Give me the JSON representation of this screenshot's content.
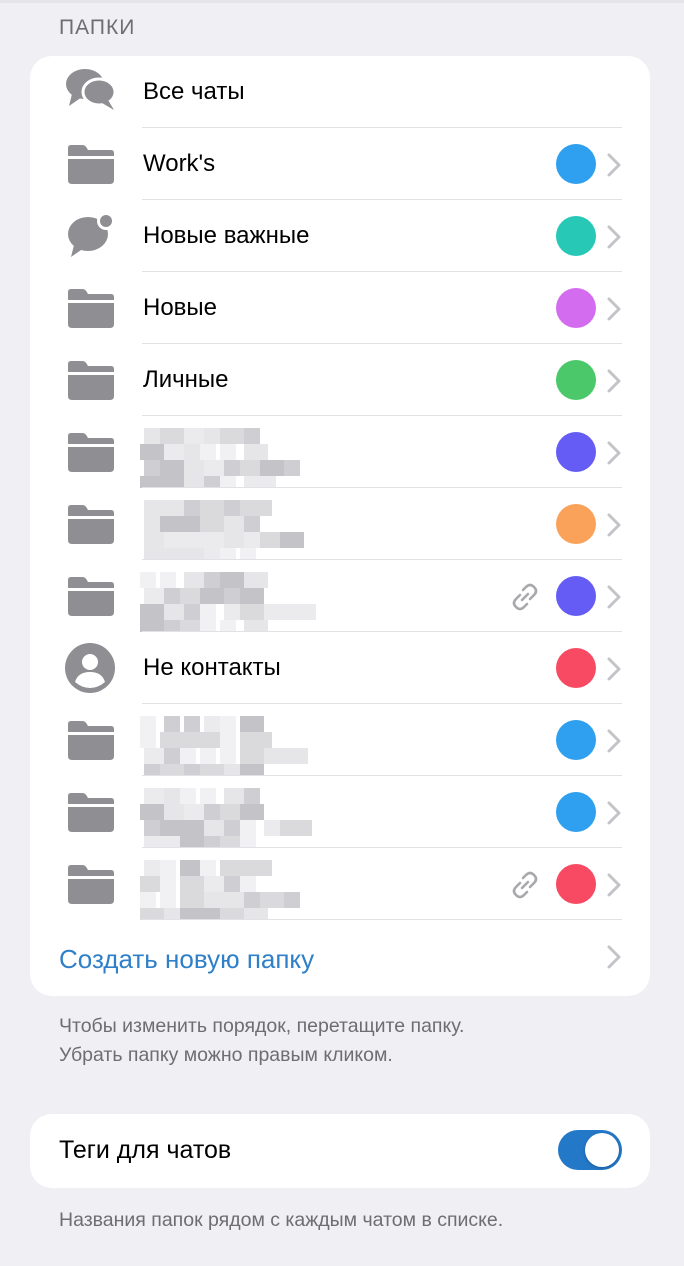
{
  "section_title": "ПАПКИ",
  "folders": [
    {
      "label": "Все чаты",
      "icon": "chat-bubbles-icon",
      "color": null,
      "blurred": false,
      "link": false
    },
    {
      "label": "Work's",
      "icon": "folder-icon",
      "color": "#2f9ff0",
      "blurred": false,
      "link": false
    },
    {
      "label": "Новые важные",
      "icon": "chat-badge-icon",
      "color": "#27c8b6",
      "blurred": false,
      "link": false
    },
    {
      "label": "Новые",
      "icon": "folder-icon",
      "color": "#d46cf0",
      "blurred": false,
      "link": false
    },
    {
      "label": "Личные",
      "icon": "folder-icon",
      "color": "#4bc86a",
      "blurred": false,
      "link": false
    },
    {
      "label": "",
      "icon": "folder-icon",
      "color": "#655bf5",
      "blurred": true,
      "link": false
    },
    {
      "label": "",
      "icon": "folder-icon",
      "color": "#fba25a",
      "blurred": true,
      "link": false
    },
    {
      "label": "",
      "icon": "folder-icon",
      "color": "#655bf5",
      "blurred": true,
      "link": true
    },
    {
      "label": "Не контакты",
      "icon": "person-circle-icon",
      "color": "#f84b63",
      "blurred": false,
      "link": false
    },
    {
      "label": "",
      "icon": "folder-icon",
      "color": "#2f9ff0",
      "blurred": true,
      "link": false
    },
    {
      "label": "",
      "icon": "folder-icon",
      "color": "#2f9ff0",
      "blurred": true,
      "link": false
    },
    {
      "label": "",
      "icon": "folder-icon",
      "color": "#f84b63",
      "blurred": true,
      "link": true
    }
  ],
  "create_folder_label": "Создать новую папку",
  "reorder_hint_line1": "Чтобы изменить порядок, перетащите папку.",
  "reorder_hint_line2": "Убрать папку можно правым кликом.",
  "tags": {
    "label": "Теги для чатов",
    "enabled": true,
    "toggle_color": "#2478c8"
  },
  "tags_hint": "Названия папок рядом с каждым чатом в списке.",
  "colors": {
    "link_accent": "#2f80c8",
    "icon_gray": "#8e8e93",
    "chevron_gray": "#c4c4c8"
  }
}
